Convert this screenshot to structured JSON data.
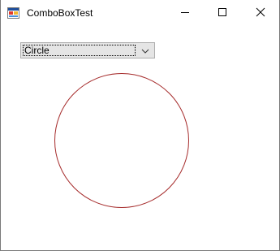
{
  "window": {
    "title": "ComboBoxTest",
    "controls": {
      "minimize": "minimize",
      "maximize": "maximize",
      "close": "close"
    }
  },
  "combobox": {
    "selected": "Circle",
    "icon": "chevron-down-icon"
  },
  "canvas": {
    "shape": "circle",
    "stroke_color": "#a52a2a"
  }
}
